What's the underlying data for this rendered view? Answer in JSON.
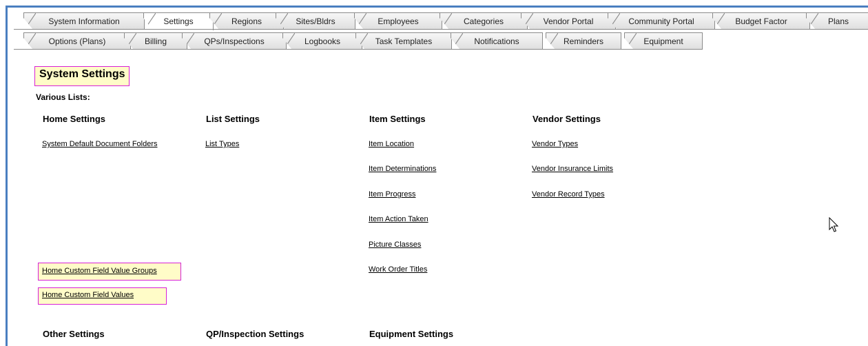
{
  "tabs_row1": [
    "System Information",
    "Settings",
    "Regions",
    "Sites/Bldrs",
    "Employees",
    "Categories",
    "Vendor Portal",
    "Community Portal",
    "Budget Factor",
    "Plans"
  ],
  "tabs_row2": [
    "Options (Plans)",
    "Billing",
    "QPs/Inspections",
    "Logbooks",
    "Task Templates",
    "Notifications",
    "Reminders",
    "Equipment"
  ],
  "active_tab": "Settings",
  "page_title": "System Settings",
  "subtitle": "Various Lists:",
  "columns": {
    "home": {
      "heading": "Home Settings",
      "links": [
        "System Default Document Folders",
        "Home Custom Field Value Groups",
        "Home Custom Field Values"
      ]
    },
    "list": {
      "heading": "List Settings",
      "links": [
        "List Types"
      ]
    },
    "item": {
      "heading": "Item Settings",
      "links": [
        "Item Location",
        "Item Determinations",
        "Item Progress",
        "Item Action Taken",
        "Picture Classes",
        "Work Order Titles"
      ]
    },
    "vendor": {
      "heading": "Vendor Settings",
      "links": [
        "Vendor Types",
        "Vendor Insurance Limits",
        "Vendor Record Types"
      ]
    }
  },
  "bottom_headings": [
    "Other Settings",
    "QP/Inspection Settings",
    "Equipment Settings"
  ],
  "colors": {
    "frame_border": "#4a7fc0",
    "highlight_fill": "#fffcc8",
    "highlight_border": "#d71fd7"
  }
}
